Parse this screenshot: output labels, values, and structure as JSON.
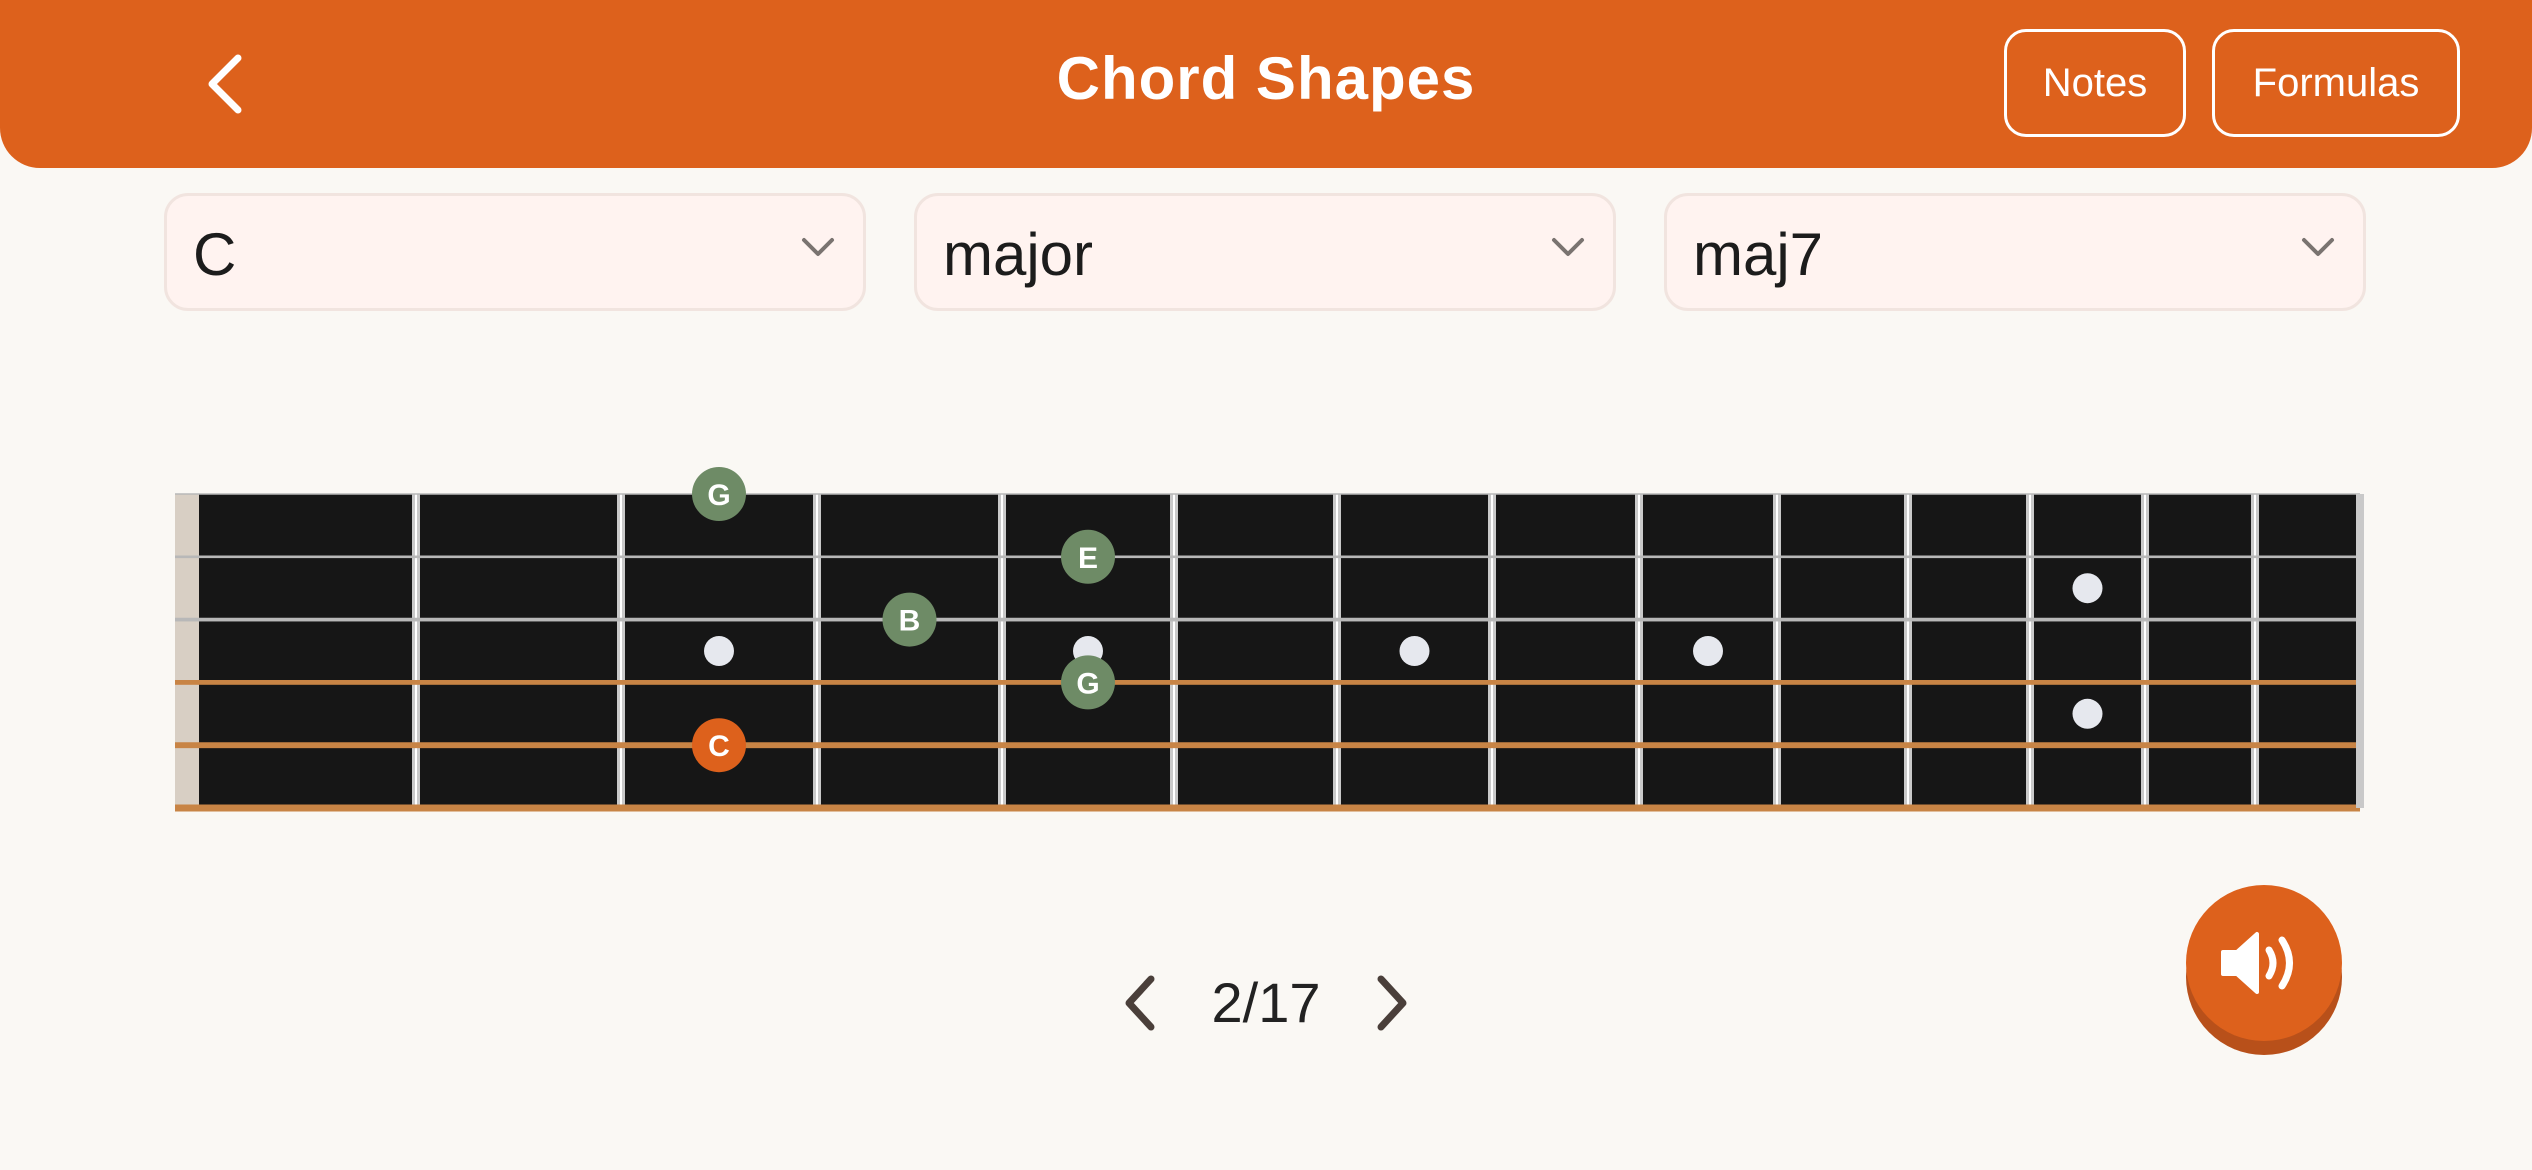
{
  "header": {
    "title": "Chord Shapes",
    "notes_label": "Notes",
    "formulas_label": "Formulas",
    "back_icon": "chevron-left-icon"
  },
  "selectors": {
    "root": {
      "value": "C"
    },
    "quality": {
      "value": "major"
    },
    "extension": {
      "value": "maj7"
    }
  },
  "fretboard": {
    "strings": 6,
    "frets_shown": 12,
    "inlay_frets": [
      3,
      5,
      7,
      9,
      12
    ],
    "notes": [
      {
        "label": "G",
        "string": 1,
        "fret": 3,
        "role": "chord-tone"
      },
      {
        "label": "E",
        "string": 2,
        "fret": 5,
        "role": "chord-tone"
      },
      {
        "label": "B",
        "string": 3,
        "fret": 4,
        "role": "chord-tone"
      },
      {
        "label": "G",
        "string": 4,
        "fret": 5,
        "role": "chord-tone"
      },
      {
        "label": "C",
        "string": 5,
        "fret": 3,
        "role": "root"
      }
    ]
  },
  "pager": {
    "text": "2/17",
    "current": 2,
    "total": 17
  },
  "sound_button": {
    "icon": "speaker-icon"
  },
  "colors": {
    "accent": "#dd611c",
    "chord_tone": "#6e8b66",
    "board": "#161616"
  }
}
